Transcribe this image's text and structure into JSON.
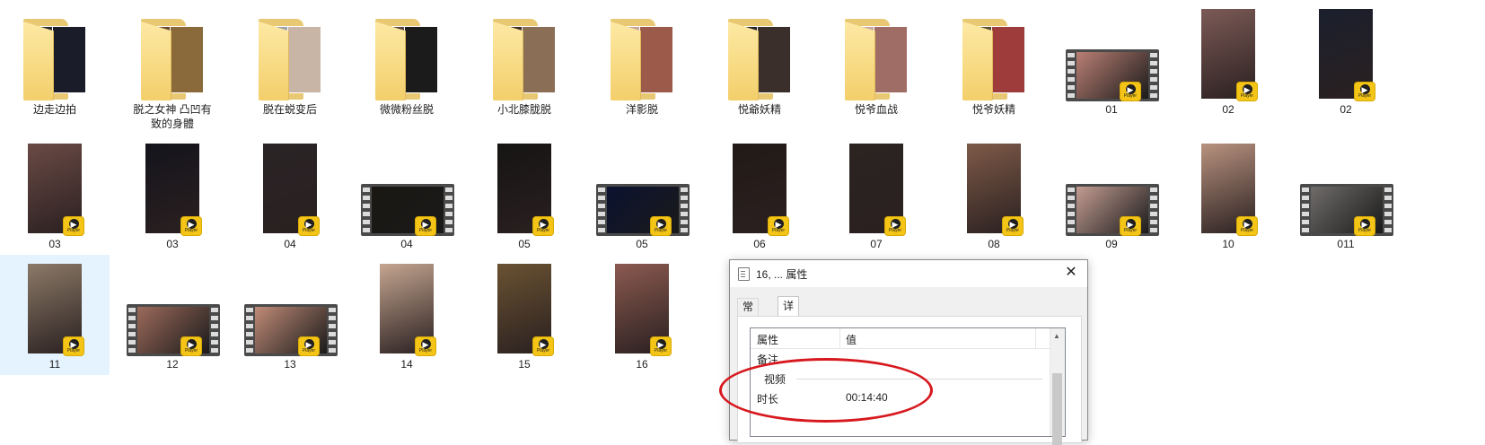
{
  "items": [
    {
      "label": "边走边拍",
      "kind": "folder",
      "photos": [
        "#2a2a33",
        "#1a1c29"
      ]
    },
    {
      "label": "脱之女神 凸凹有致的身體",
      "kind": "folder",
      "photos": [
        "#6b4a2a",
        "#8a6a3a"
      ]
    },
    {
      "label": "脱在蜕变后",
      "kind": "folder",
      "photos": [
        "#9aa0ad",
        "#c8b5a6"
      ]
    },
    {
      "label": "微微粉丝脱",
      "kind": "folder",
      "photos": [
        "#5a4540",
        "#1b1b1b"
      ]
    },
    {
      "label": "小北膝胧脱",
      "kind": "folder",
      "photos": [
        "#3b2c22",
        "#8a6e56"
      ]
    },
    {
      "label": "洋影脱",
      "kind": "folder",
      "photos": [
        "#c7a397",
        "#9b5a4a"
      ]
    },
    {
      "label": "悦爺妖精",
      "kind": "folder",
      "photos": [
        "#222",
        "#3a2f2b"
      ]
    },
    {
      "label": "悦爷血战",
      "kind": "folder",
      "photos": [
        "#caa6a0",
        "#9f6c66"
      ]
    },
    {
      "label": "悦爷妖精",
      "kind": "folder",
      "photos": [
        "#5c4e2c",
        "#9e3b3b"
      ]
    },
    {
      "label": "01",
      "kind": "film",
      "color": "#b97f74"
    },
    {
      "label": "02",
      "kind": "portrait",
      "color": "#7c5a56"
    },
    {
      "label": "02",
      "kind": "portrait",
      "color": "#1b1f2d"
    },
    {
      "label": "03",
      "kind": "portrait",
      "color": "#6a4a45"
    },
    {
      "label": "03",
      "kind": "portrait",
      "color": "#14141c"
    },
    {
      "label": "04",
      "kind": "portrait",
      "color": "#2a2426"
    },
    {
      "label": "04",
      "kind": "film",
      "color": "#1a1712"
    },
    {
      "label": "05",
      "kind": "portrait",
      "color": "#161414"
    },
    {
      "label": "05",
      "kind": "film",
      "color": "#0b1230"
    },
    {
      "label": "06",
      "kind": "portrait",
      "color": "#221a17"
    },
    {
      "label": "07",
      "kind": "portrait",
      "color": "#2b2421"
    },
    {
      "label": "08",
      "kind": "portrait",
      "color": "#7e5a48"
    },
    {
      "label": "09",
      "kind": "film",
      "color": "#c39c92"
    },
    {
      "label": "10",
      "kind": "portrait",
      "color": "#b8927f"
    },
    {
      "label": "011",
      "kind": "film",
      "color": "#6f6c6a"
    },
    {
      "label": "11",
      "kind": "portrait",
      "color": "#8c7a68",
      "selected": true
    },
    {
      "label": "12",
      "kind": "film",
      "color": "#9c6a5b"
    },
    {
      "label": "13",
      "kind": "film",
      "color": "#c08b77"
    },
    {
      "label": "14",
      "kind": "portrait",
      "color": "#c4a590"
    },
    {
      "label": "15",
      "kind": "portrait",
      "color": "#6a5232"
    },
    {
      "label": "16",
      "kind": "portrait",
      "color": "#8b5a50"
    }
  ],
  "badge_text": "Player",
  "dialog": {
    "title": "16, ... 属性",
    "close": "✕",
    "tabs": [
      "常规",
      "详细信息"
    ],
    "header_property": "属性",
    "header_value": "值",
    "row_note": "备注",
    "group_video": "视频",
    "row_duration_label": "时长",
    "row_duration_value": "00:14:40",
    "scroll_up": "▲"
  },
  "colors": {
    "selection": "#e5f3ff",
    "badge": "#f4c516",
    "highlight": "#d7191f"
  }
}
